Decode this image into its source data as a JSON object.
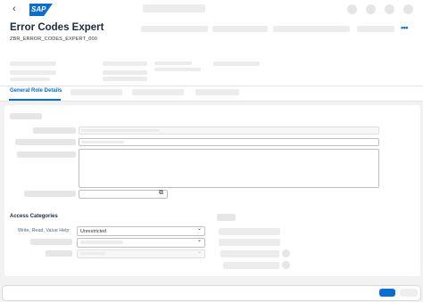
{
  "shell": {
    "back_icon": "‹",
    "logo_text": "SAP"
  },
  "header": {
    "title": "Error Codes Expert",
    "subtitle": "ZBR_ERROR_CODES_EXPERT_000",
    "more_icon": "•••"
  },
  "tabs": {
    "active_label": "General Role Details"
  },
  "access": {
    "section_title": "Access Categories",
    "row_label": "Write, Read, Value Help:",
    "row_value": "Unrestricted"
  },
  "icons": {
    "copy_icon": "⧉",
    "chevron": "⌄"
  },
  "colors": {
    "accent": "#0a6ed1",
    "background": "#f2f2f2"
  }
}
